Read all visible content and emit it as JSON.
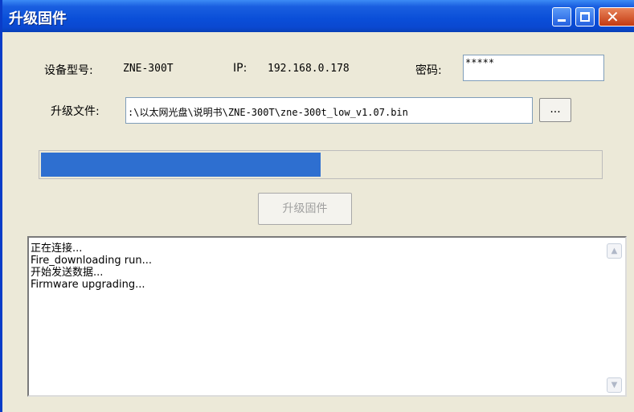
{
  "window": {
    "title": "升级固件",
    "close_glyph": "✕"
  },
  "device": {
    "model_label": "设备型号:",
    "model_value": "ZNE-300T",
    "ip_label": "IP:",
    "ip_value": "192.168.0.178",
    "password_label": "密码:",
    "password_value": "*****"
  },
  "file": {
    "label": "升级文件:",
    "path_value": ":\\以太网光盘\\说明书\\ZNE-300T\\zne-300t_low_v1.07.bin",
    "browse_label": "..."
  },
  "progress": {
    "fraction": 0.5
  },
  "upgrade_button": {
    "label": "升级固件",
    "enabled": false
  },
  "log": {
    "lines": [
      "正在连接...",
      "Fire_downloading run...",
      "开始发送数据...",
      "Firmware upgrading..."
    ]
  },
  "scroll": {
    "up_icon": "▲",
    "down_icon": "▼"
  },
  "colors": {
    "titlebar": "#0a4ed8",
    "progress_fill": "#2e6fd0",
    "close_button": "#c43a12"
  }
}
